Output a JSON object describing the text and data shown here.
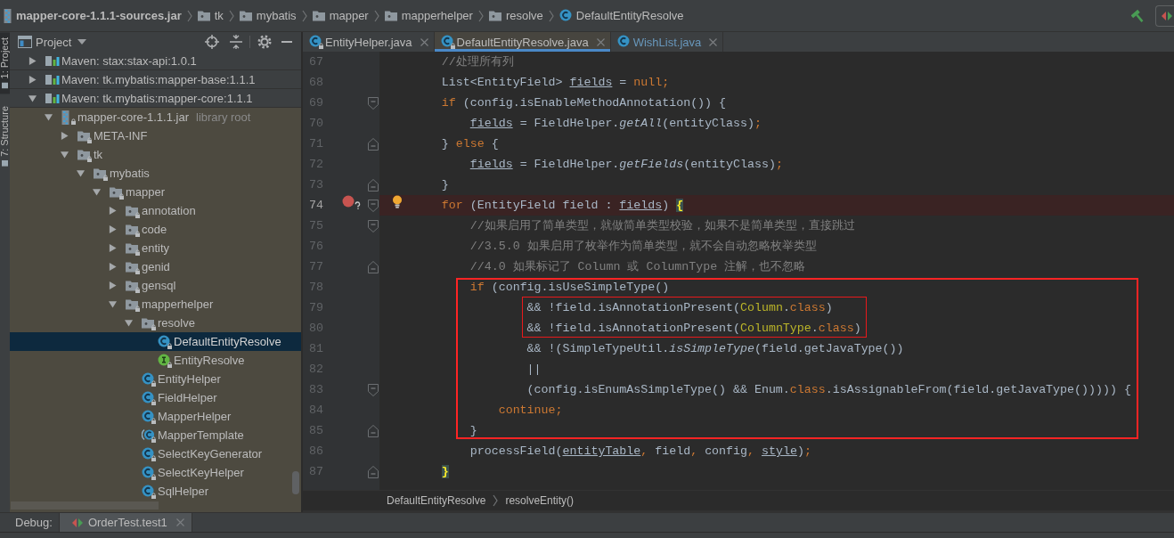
{
  "breadcrumb": [
    {
      "label": "mapper-core-1.1.1-sources.jar",
      "kind": "jar"
    },
    {
      "label": "tk",
      "kind": "package"
    },
    {
      "label": "mybatis",
      "kind": "package"
    },
    {
      "label": "mapper",
      "kind": "package"
    },
    {
      "label": "mapperhelper",
      "kind": "package"
    },
    {
      "label": "resolve",
      "kind": "package"
    },
    {
      "label": "DefaultEntityResolve",
      "kind": "class"
    }
  ],
  "tool_strip": [
    {
      "label": "1: Project",
      "selected": true
    },
    {
      "label": "7: Structure",
      "selected": false
    }
  ],
  "project_panel": {
    "title": "Project",
    "tree": [
      {
        "label": "Maven: stax:stax-api:1.0.1",
        "kind": "library",
        "expanded": false,
        "selected": false
      },
      {
        "label": "Maven: tk.mybatis:mapper-base:1.1.1",
        "kind": "library",
        "expanded": false,
        "selected": false
      },
      {
        "label": "Maven: tk.mybatis:mapper-core:1.1.1",
        "kind": "library",
        "expanded": true,
        "selected": false,
        "children": [
          {
            "label": "mapper-core-1.1.1.jar",
            "note": "library root",
            "kind": "jar",
            "expanded": true,
            "selected": false,
            "children": [
              {
                "label": "META-INF",
                "kind": "package",
                "expanded": false,
                "selected": false
              },
              {
                "label": "tk",
                "kind": "package",
                "expanded": true,
                "selected": false,
                "children": [
                  {
                    "label": "mybatis",
                    "kind": "package",
                    "expanded": true,
                    "selected": false,
                    "children": [
                      {
                        "label": "mapper",
                        "kind": "package",
                        "expanded": true,
                        "selected": false,
                        "children": [
                          {
                            "label": "annotation",
                            "kind": "package",
                            "expanded": false,
                            "selected": false
                          },
                          {
                            "label": "code",
                            "kind": "package",
                            "expanded": false,
                            "selected": false
                          },
                          {
                            "label": "entity",
                            "kind": "package",
                            "expanded": false,
                            "selected": false
                          },
                          {
                            "label": "genid",
                            "kind": "package",
                            "expanded": false,
                            "selected": false
                          },
                          {
                            "label": "gensql",
                            "kind": "package",
                            "expanded": false,
                            "selected": false
                          },
                          {
                            "label": "mapperhelper",
                            "kind": "package",
                            "expanded": true,
                            "selected": false,
                            "children": [
                              {
                                "label": "resolve",
                                "kind": "package",
                                "expanded": true,
                                "selected": false,
                                "children": [
                                  {
                                    "label": "DefaultEntityResolve",
                                    "kind": "class",
                                    "selected": true
                                  },
                                  {
                                    "label": "EntityResolve",
                                    "kind": "interface",
                                    "selected": false
                                  }
                                ]
                              },
                              {
                                "label": "EntityHelper",
                                "kind": "class",
                                "selected": false
                              },
                              {
                                "label": "FieldHelper",
                                "kind": "class",
                                "selected": false
                              },
                              {
                                "label": "MapperHelper",
                                "kind": "class",
                                "selected": false
                              },
                              {
                                "label": "MapperTemplate",
                                "kind": "abstract_class",
                                "selected": false
                              },
                              {
                                "label": "SelectKeyGenerator",
                                "kind": "class",
                                "selected": false
                              },
                              {
                                "label": "SelectKeyHelper",
                                "kind": "class",
                                "selected": false
                              },
                              {
                                "label": "SqlHelper",
                                "kind": "class",
                                "selected": false
                              }
                            ]
                          }
                        ]
                      }
                    ]
                  }
                ]
              }
            ]
          }
        ]
      }
    ]
  },
  "editor_tabs": [
    {
      "label": "EntityHelper.java",
      "selected": false,
      "locked": true,
      "color": "#bbbbbb"
    },
    {
      "label": "DefaultEntityResolve.java",
      "selected": true,
      "locked": true,
      "color": "#bbbbbb"
    },
    {
      "label": "WishList.java",
      "selected": false,
      "locked": false,
      "color": "#6897bb"
    }
  ],
  "code": {
    "lines": [
      {
        "kind": "line",
        "number": "67",
        "tokens": [
          {
            "text": "        //处理所有列",
            "kind": "comment"
          }
        ],
        "breakpoint": false,
        "current": false
      },
      {
        "kind": "line",
        "number": "68",
        "tokens": [
          {
            "text": "        List<EntityField> ",
            "kind": "plain"
          },
          {
            "text": "fields",
            "kind": "var"
          },
          {
            "text": " = ",
            "kind": "plain"
          },
          {
            "text": "null",
            "kind": "keyword"
          },
          {
            "text": ";",
            "kind": "punct"
          }
        ],
        "breakpoint": false,
        "current": false
      },
      {
        "kind": "line",
        "number": "69",
        "tokens": [
          {
            "text": "        if",
            "kind": "keyword"
          },
          {
            "text": " (config.isEnableMethodAnnotation()) {",
            "kind": "plain"
          }
        ],
        "fold": {
          "kind": "start"
        },
        "breakpoint": false,
        "current": false
      },
      {
        "kind": "line",
        "number": "70",
        "tokens": [
          {
            "text": "            fields",
            "kind": "var"
          },
          {
            "text": " = FieldHelper.",
            "kind": "plain"
          },
          {
            "text": "getAll",
            "kind": "static"
          },
          {
            "text": "(entityClass)",
            "kind": "plain"
          },
          {
            "text": ";",
            "kind": "punct"
          }
        ],
        "breakpoint": false,
        "current": false
      },
      {
        "kind": "line",
        "number": "71",
        "tokens": [
          {
            "text": "        } ",
            "kind": "plain"
          },
          {
            "text": "else",
            "kind": "keyword"
          },
          {
            "text": " {",
            "kind": "plain"
          }
        ],
        "fold": {
          "kind": "end"
        },
        "breakpoint": false,
        "current": false
      },
      {
        "kind": "line",
        "number": "72",
        "tokens": [
          {
            "text": "            fields",
            "kind": "var"
          },
          {
            "text": " = FieldHelper.",
            "kind": "plain"
          },
          {
            "text": "getFields",
            "kind": "static"
          },
          {
            "text": "(entityClass)",
            "kind": "plain"
          },
          {
            "text": ";",
            "kind": "punct"
          }
        ],
        "breakpoint": false,
        "current": false
      },
      {
        "kind": "line",
        "number": "73",
        "tokens": [
          {
            "text": "        }",
            "kind": "plain"
          }
        ],
        "fold": {
          "kind": "end"
        },
        "breakpoint": false,
        "current": false
      },
      {
        "kind": "line",
        "number": "74",
        "tokens": [
          {
            "text": "        for",
            "kind": "keyword"
          },
          {
            "text": " (EntityField field : ",
            "kind": "plain"
          },
          {
            "text": "fields",
            "kind": "var"
          },
          {
            "text": ") ",
            "kind": "plain"
          },
          {
            "text": "{",
            "kind": "brace"
          }
        ],
        "fold": {
          "kind": "start"
        },
        "breakpoint": true,
        "current": true
      },
      {
        "kind": "line",
        "number": "75",
        "tokens": [
          {
            "text": "            //如果启用了简单类型，就做简单类型校验，如果不是简单类型，直接跳过",
            "kind": "comment"
          }
        ],
        "fold": {
          "kind": "start"
        },
        "breakpoint": false,
        "current": false
      },
      {
        "kind": "line",
        "number": "76",
        "tokens": [
          {
            "text": "            //3.5.0 如果启用了枚举作为简单类型，就不会自动忽略枚举类型",
            "kind": "comment"
          }
        ],
        "breakpoint": false,
        "current": false
      },
      {
        "kind": "line",
        "number": "77",
        "tokens": [
          {
            "text": "            //4.0 如果标记了 Column 或 ColumnType 注解，也不忽略",
            "kind": "comment"
          }
        ],
        "fold": {
          "kind": "end"
        },
        "breakpoint": false,
        "current": false
      },
      {
        "kind": "frame",
        "lines": [
          {
            "kind": "line",
            "number": "78",
            "tokens": [
              {
                "text": "            if",
                "kind": "keyword"
              },
              {
                "text": " (config.isUseSimpleType()",
                "kind": "plain"
              }
            ],
            "breakpoint": false,
            "current": false
          },
          {
            "kind": "frame",
            "lines": [
              {
                "kind": "line",
                "number": "79",
                "tokens": [
                  {
                    "text": "                    && !field.isAnnotationPresent(",
                    "kind": "plain"
                  },
                  {
                    "text": "Column",
                    "kind": "type"
                  },
                  {
                    "text": ".",
                    "kind": "plain"
                  },
                  {
                    "text": "class",
                    "kind": "keyword"
                  },
                  {
                    "text": ")",
                    "kind": "plain"
                  }
                ],
                "breakpoint": false,
                "current": false
              },
              {
                "kind": "line",
                "number": "80",
                "tokens": [
                  {
                    "text": "                    && !field.isAnnotationPresent(",
                    "kind": "plain"
                  },
                  {
                    "text": "ColumnType",
                    "kind": "type"
                  },
                  {
                    "text": ".",
                    "kind": "plain"
                  },
                  {
                    "text": "class",
                    "kind": "keyword"
                  },
                  {
                    "text": ")",
                    "kind": "plain"
                  }
                ],
                "breakpoint": false,
                "current": false
              }
            ]
          },
          {
            "kind": "line",
            "number": "81",
            "tokens": [
              {
                "text": "                    && !(SimpleTypeUtil.",
                "kind": "plain"
              },
              {
                "text": "isSimpleType",
                "kind": "static"
              },
              {
                "text": "(field.getJavaType())",
                "kind": "plain"
              }
            ],
            "breakpoint": false,
            "current": false
          },
          {
            "kind": "line",
            "number": "82",
            "tokens": [
              {
                "text": "                    ||",
                "kind": "plain"
              }
            ],
            "breakpoint": false,
            "current": false
          },
          {
            "kind": "line",
            "number": "83",
            "tokens": [
              {
                "text": "                    (config.isEnumAsSimpleType() && Enum.",
                "kind": "plain"
              },
              {
                "text": "class",
                "kind": "keyword"
              },
              {
                "text": ".isAssignableFrom(field.getJavaType())))) {",
                "kind": "plain"
              }
            ],
            "fold": {
              "kind": "start"
            },
            "breakpoint": false,
            "current": false
          },
          {
            "kind": "line",
            "number": "84",
            "tokens": [
              {
                "text": "                continue",
                "kind": "keyword"
              },
              {
                "text": ";",
                "kind": "punct"
              }
            ],
            "breakpoint": false,
            "current": false
          },
          {
            "kind": "line",
            "number": "85",
            "tokens": [
              {
                "text": "            }",
                "kind": "plain"
              }
            ],
            "fold": {
              "kind": "end"
            },
            "breakpoint": false,
            "current": false
          }
        ]
      },
      {
        "kind": "line",
        "number": "86",
        "tokens": [
          {
            "text": "            processField(",
            "kind": "plain"
          },
          {
            "text": "entityTable",
            "kind": "var"
          },
          {
            "text": ", ",
            "kind": "punct"
          },
          {
            "text": "field",
            "kind": "plain"
          },
          {
            "text": ", ",
            "kind": "punct"
          },
          {
            "text": "config",
            "kind": "plain"
          },
          {
            "text": ", ",
            "kind": "punct"
          },
          {
            "text": "style",
            "kind": "var"
          },
          {
            "text": ")",
            "kind": "plain"
          },
          {
            "text": ";",
            "kind": "punct"
          }
        ],
        "breakpoint": false,
        "current": false
      },
      {
        "kind": "line",
        "number": "87",
        "tokens": [
          {
            "text": "        }",
            "kind": "brace"
          }
        ],
        "fold": {
          "kind": "end"
        },
        "breakpoint": false,
        "current": false
      }
    ]
  },
  "editor_breadcrumb": [
    "DefaultEntityResolve",
    "resolveEntity()"
  ],
  "debug_bar": {
    "label": "Debug:",
    "tabs": [
      {
        "label": "OrderTest.test1",
        "selected": true
      }
    ]
  }
}
